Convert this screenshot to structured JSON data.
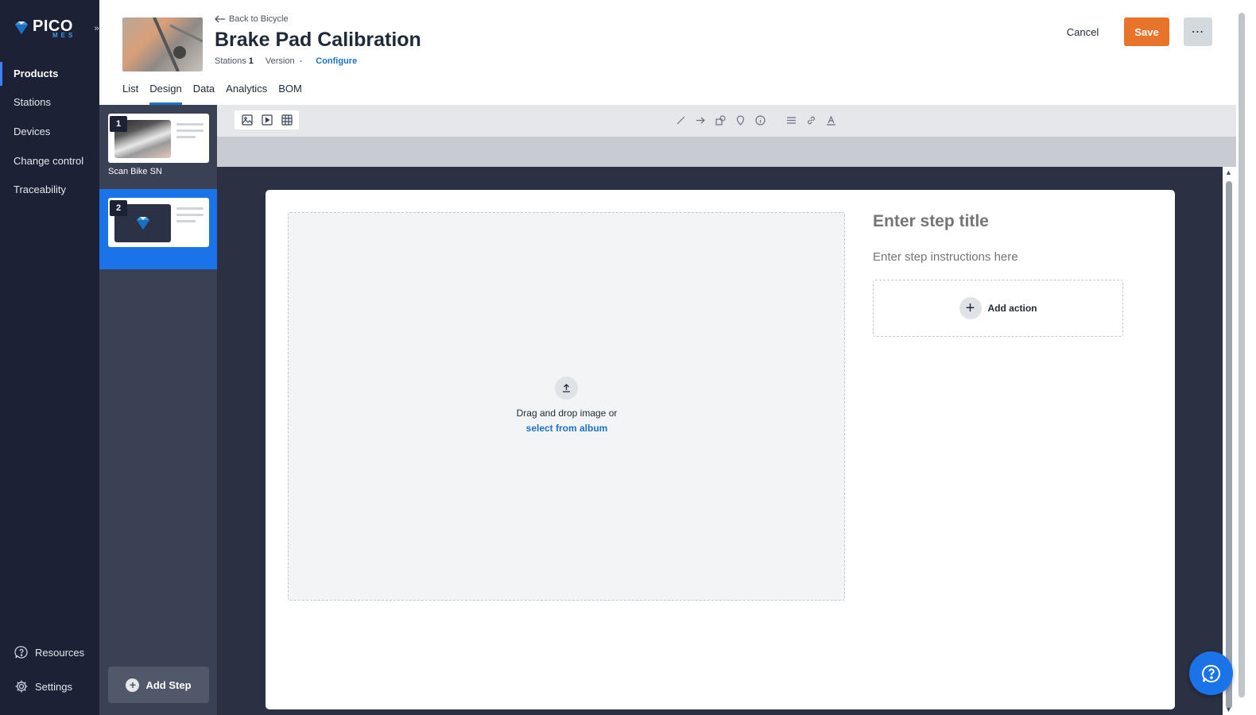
{
  "app": {
    "logo_text": "PICO",
    "logo_sub": "MES",
    "collapse_icon": "chevron-double-right-icon"
  },
  "sidebar": {
    "items": [
      {
        "label": "Products",
        "active": true
      },
      {
        "label": "Stations",
        "active": false
      },
      {
        "label": "Devices",
        "active": false
      },
      {
        "label": "Change control",
        "active": false
      },
      {
        "label": "Traceability",
        "active": false
      }
    ],
    "bottom": [
      {
        "label": "Resources",
        "icon": "help-circle-icon"
      },
      {
        "label": "Settings",
        "icon": "gear-icon"
      }
    ]
  },
  "header": {
    "back_label": "Back to Bicycle",
    "title": "Brake Pad Calibration",
    "stations_label": "Stations",
    "stations_value": "1",
    "version_label": "Version",
    "version_value": "-",
    "configure_label": "Configure",
    "tabs": [
      {
        "label": "List",
        "active": false
      },
      {
        "label": "Design",
        "active": true
      },
      {
        "label": "Data",
        "active": false
      },
      {
        "label": "Analytics",
        "active": false
      },
      {
        "label": "BOM",
        "active": false
      }
    ],
    "cancel_label": "Cancel",
    "save_label": "Save",
    "more_label": "⋯"
  },
  "steps": [
    {
      "number": "1",
      "label": "Scan Bike SN",
      "selected": false
    },
    {
      "number": "2",
      "label": "",
      "selected": true
    }
  ],
  "add_step_label": "Add Step",
  "toolbar": {
    "left_icons": [
      "image-icon",
      "video-icon",
      "table-icon"
    ],
    "right_icons": [
      "line-icon",
      "arrow-icon",
      "shape-icon",
      "marker-icon",
      "info-icon",
      "align-icon",
      "link-icon",
      "text-color-icon"
    ]
  },
  "editor": {
    "drop_text": "Drag and drop image or",
    "drop_link": "select from album",
    "title_placeholder": "Enter step title",
    "instructions_placeholder": "Enter step instructions here",
    "add_action_label": "Add action"
  },
  "colors": {
    "sidebar_bg": "#1c2135",
    "accent_blue": "#1a73e8",
    "save_orange": "#e8732a",
    "link_blue": "#1a73c7"
  }
}
